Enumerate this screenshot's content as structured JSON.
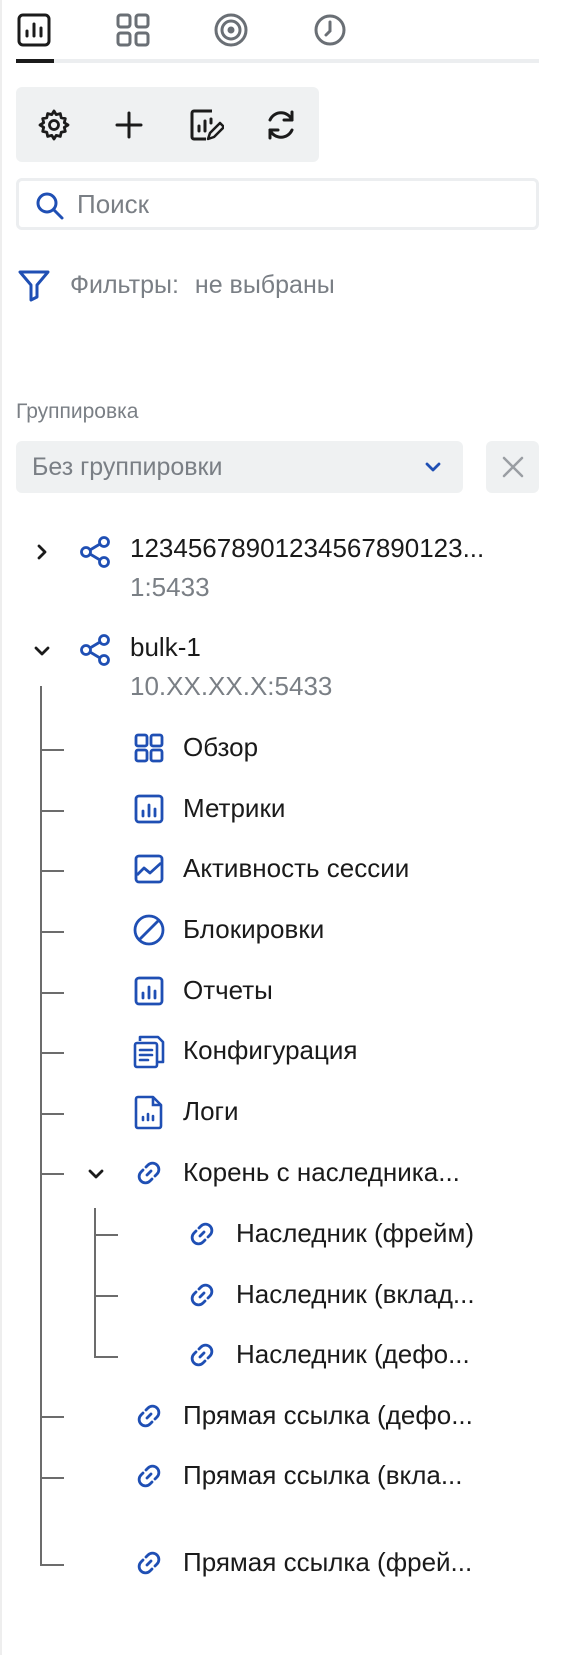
{
  "tabs": [
    {
      "name": "metrics",
      "icon": "bar-chart-icon",
      "active": true
    },
    {
      "name": "dashboards",
      "icon": "grid-icon",
      "active": false
    },
    {
      "name": "target",
      "icon": "target-icon",
      "active": false
    },
    {
      "name": "history",
      "icon": "clock-icon",
      "active": false
    }
  ],
  "toolbar": {
    "buttons": [
      "gear-icon",
      "plus-icon",
      "edit-report-icon",
      "refresh-icon"
    ]
  },
  "search": {
    "placeholder": "Поиск",
    "value": ""
  },
  "filters": {
    "label": "Фильтры:",
    "value": "не выбраны"
  },
  "grouping": {
    "label": "Группировка",
    "selected": "Без группировки"
  },
  "tree": {
    "nodes": [
      {
        "title": "12345678901234567890123...",
        "subtitle": "1:5433",
        "expanded": false
      },
      {
        "title": "bulk-1",
        "subtitle": "10.XX.XX.X:5433",
        "expanded": true,
        "items": [
          {
            "label": "Обзор",
            "icon": "grid-icon"
          },
          {
            "label": "Метрики",
            "icon": "bar-chart-icon"
          },
          {
            "label": "Активность сессии",
            "icon": "area-chart-icon"
          },
          {
            "label": "Блокировки",
            "icon": "blocked-icon"
          },
          {
            "label": "Отчеты",
            "icon": "bar-chart-icon"
          },
          {
            "label": "Конфигурация",
            "icon": "config-doc-icon"
          },
          {
            "label": "Логи",
            "icon": "log-file-icon"
          },
          {
            "label": "Корень с наследника...",
            "icon": "link-icon",
            "expanded": true,
            "children": [
              {
                "label": "Наследник (фрейм)",
                "icon": "link-icon"
              },
              {
                "label": "Наследник (вклад...",
                "icon": "link-icon"
              },
              {
                "label": "Наследник (дефо...",
                "icon": "link-icon"
              }
            ]
          },
          {
            "label": "Прямая ссылка (дефо...",
            "icon": "link-icon"
          },
          {
            "label": "Прямая ссылка (вкла...",
            "icon": "link-icon"
          },
          {
            "label": "Прямая ссылка (фрей...",
            "icon": "link-icon"
          }
        ]
      }
    ]
  },
  "colors": {
    "icon_blue": "#1f4fb4",
    "text": "#1a1a1a",
    "muted": "#7a7f85",
    "panel_bg": "#eff1f2",
    "tree_line": "#6c6c6c"
  }
}
